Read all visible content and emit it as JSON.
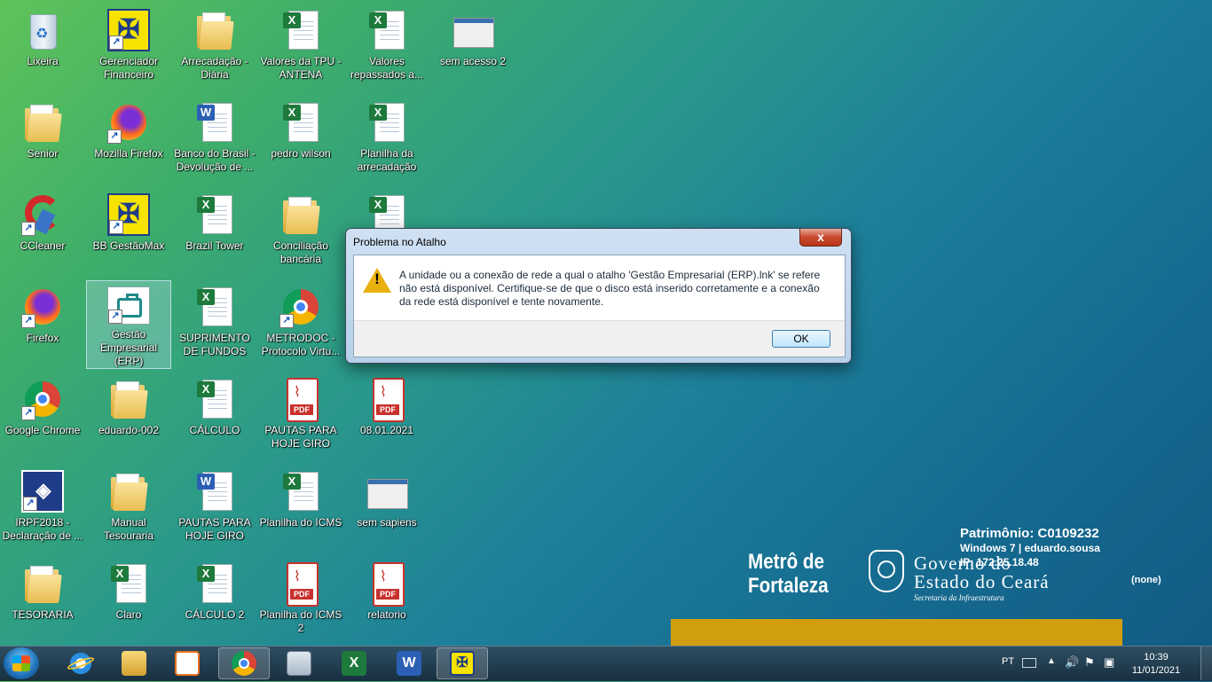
{
  "desktop": {
    "icons": [
      {
        "label": "Lixeira",
        "type": "recycle-bin",
        "shortcut": false
      },
      {
        "label": "Gerenciador Financeiro",
        "type": "bb",
        "shortcut": true
      },
      {
        "label": "Arrecadação - Diária",
        "type": "folder",
        "shortcut": false
      },
      {
        "label": "Valores da TPU - ANTENA",
        "type": "excel",
        "shortcut": false
      },
      {
        "label": "Valores repassados a...",
        "type": "excel",
        "shortcut": false
      },
      {
        "label": "sem acesso 2",
        "type": "screenshot",
        "shortcut": false
      },
      {
        "label": "Senior",
        "type": "folder",
        "shortcut": false
      },
      {
        "label": "Mozilla Firefox",
        "type": "firefox",
        "shortcut": true
      },
      {
        "label": "Banco do Brasil - Devolução de ...",
        "type": "word",
        "shortcut": false
      },
      {
        "label": "pedro wilson",
        "type": "excel",
        "shortcut": false
      },
      {
        "label": "Planilha da arrecadação",
        "type": "excel",
        "shortcut": false
      },
      {
        "label": "CCleaner",
        "type": "ccleaner",
        "shortcut": true
      },
      {
        "label": "BB GestãoMax",
        "type": "bb",
        "shortcut": true
      },
      {
        "label": "Brazil Tower",
        "type": "excel",
        "shortcut": false
      },
      {
        "label": "Conciliação bancária",
        "type": "folder",
        "shortcut": false
      },
      {
        "label": "",
        "type": "excel",
        "shortcut": false
      },
      {
        "label": "Firefox",
        "type": "firefox",
        "shortcut": true
      },
      {
        "label": "Gestão Empresarial (ERP)",
        "type": "erp",
        "shortcut": true,
        "selected": true
      },
      {
        "label": "SUPRIMENTO DE FUNDOS",
        "type": "excel",
        "shortcut": false
      },
      {
        "label": "METRODOC - Protocolo Virtu...",
        "type": "chrome",
        "shortcut": true
      },
      {
        "label": "Google Chrome",
        "type": "chrome",
        "shortcut": true
      },
      {
        "label": "eduardo-002",
        "type": "folder",
        "shortcut": false
      },
      {
        "label": "CÁLCULO",
        "type": "excel",
        "shortcut": false
      },
      {
        "label": "PAUTAS PARA HOJE GIRO",
        "type": "pdf",
        "shortcut": false
      },
      {
        "label": "08.01.2021",
        "type": "pdf",
        "shortcut": false
      },
      {
        "label": "IRPF2018 - Declaração de ...",
        "type": "irpf",
        "shortcut": true
      },
      {
        "label": "Manual Tesouraria",
        "type": "folder",
        "shortcut": false
      },
      {
        "label": "PAUTAS PARA HOJE GIRO",
        "type": "word",
        "shortcut": false
      },
      {
        "label": "Planilha do ICMS",
        "type": "excel",
        "shortcut": false
      },
      {
        "label": "sem sapiens",
        "type": "screenshot",
        "shortcut": false
      },
      {
        "label": "TESORARIA",
        "type": "folder",
        "shortcut": false
      },
      {
        "label": "Claro",
        "type": "excel",
        "shortcut": false
      },
      {
        "label": "CÁLCULO 2",
        "type": "excel",
        "shortcut": false
      },
      {
        "label": "Planilha do ICMS 2",
        "type": "pdf",
        "shortcut": false
      },
      {
        "label": "relatorio",
        "type": "pdf",
        "shortcut": false
      }
    ]
  },
  "dialog": {
    "title": "Problema no Atalho",
    "close_glyph": "x",
    "message": "A unidade ou a conexão de rede a qual o atalho 'Gestão Empresarial (ERP).lnk' se refere não está disponível. Certifique-se de que o disco está inserido corretamente e a conexão da rede está disponível e tente novamente.",
    "ok_label": "OK",
    "warning_mark": "!"
  },
  "wallpaper": {
    "patrimonio": "Patrimônio: C0109232",
    "os_user": "Windows 7 | eduardo.sousa",
    "ip": "IP: 172.25.18.48",
    "none": "(none)",
    "metro_line1": "Metrô de",
    "metro_line2": "Fortaleza",
    "gov_line1": "Governo do",
    "gov_line2": "Estado do Ceará",
    "gov_line3": "Secretaria da Infraestrutura",
    "gold_color": "#d19e10"
  },
  "taskbar": {
    "items": [
      "start-orb",
      "internet-explorer",
      "windows-explorer",
      "media-player",
      "google-chrome",
      "calculator",
      "excel",
      "word",
      "bb-gerenciador"
    ],
    "excel_glyph": "X",
    "word_glyph": "W",
    "bb_glyph": "✠",
    "tray": {
      "language": "PT",
      "up_arrow": "▲",
      "volume": "🔊",
      "flag": "⚑",
      "network": "▣",
      "time": "10:39",
      "date": "11/01/2021"
    }
  }
}
